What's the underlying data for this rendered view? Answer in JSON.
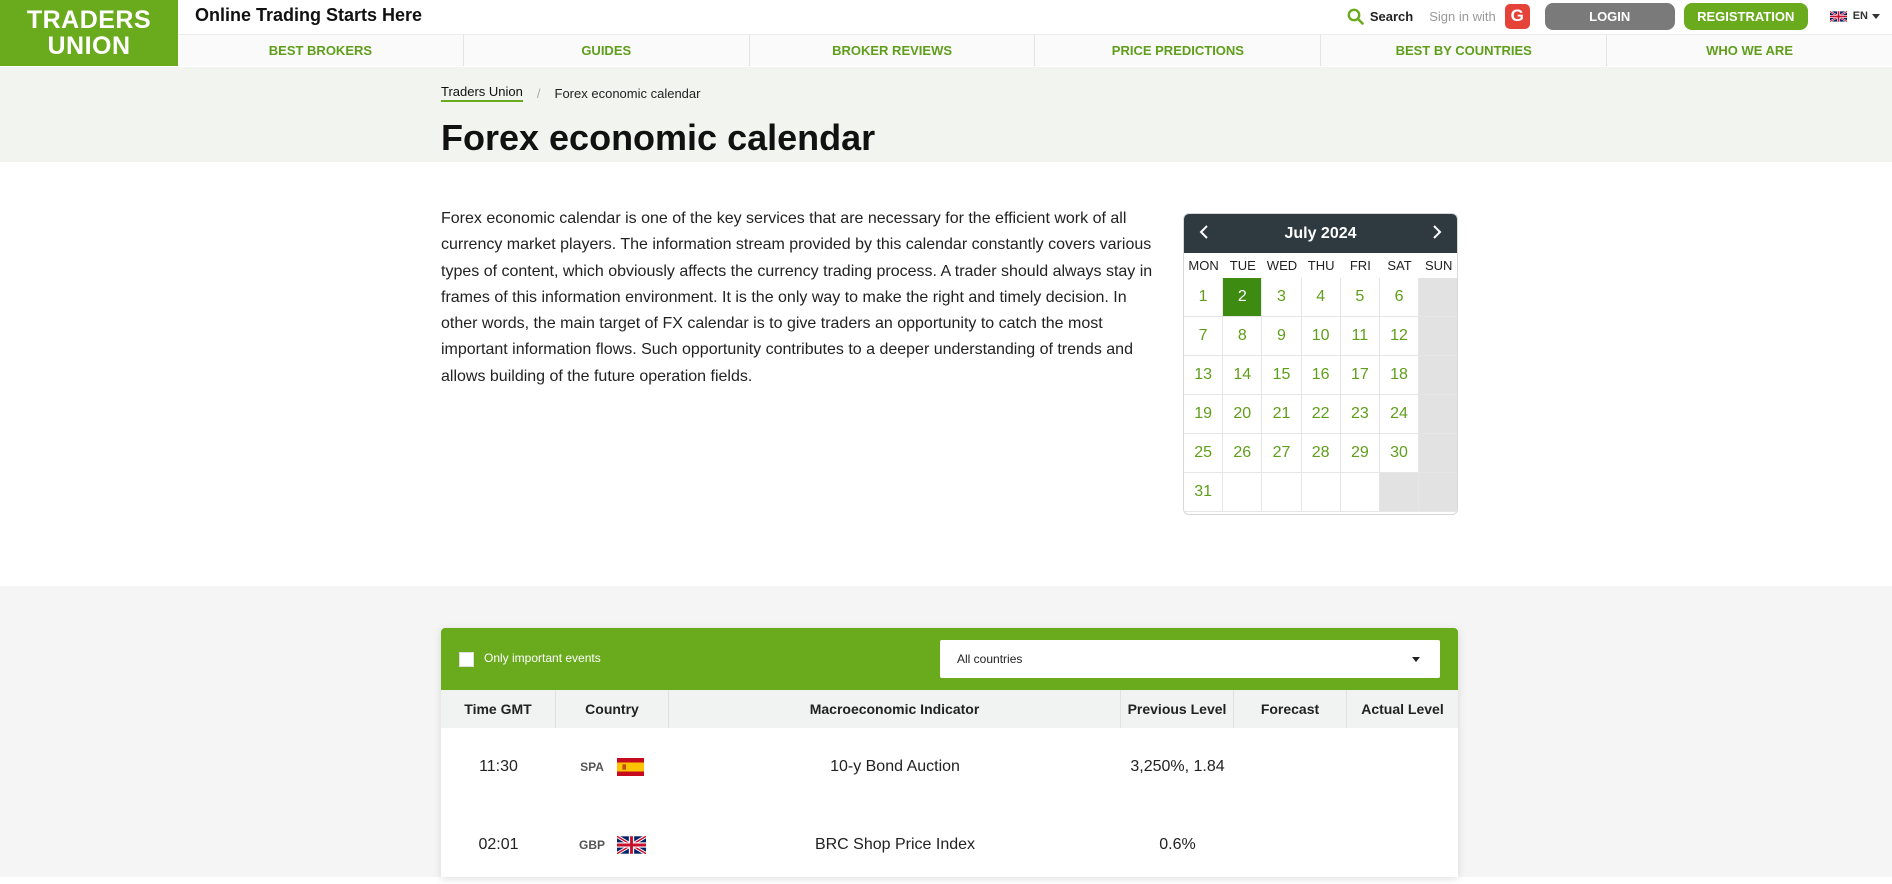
{
  "header": {
    "logo_line1": "TRADERS",
    "logo_line2": "UNION",
    "tagline": "Online Trading Starts Here",
    "search_label": "Search",
    "signin_label": "Sign in with",
    "google_label": "G",
    "login_label": "LOGIN",
    "register_label": "REGISTRATION",
    "lang_label": "EN"
  },
  "nav": {
    "items": [
      {
        "label": "BEST BROKERS"
      },
      {
        "label": "GUIDES"
      },
      {
        "label": "BROKER REVIEWS"
      },
      {
        "label": "PRICE PREDICTIONS"
      },
      {
        "label": "BEST BY COUNTRIES"
      },
      {
        "label": "WHO WE ARE"
      }
    ]
  },
  "breadcrumb": {
    "home": "Traders Union",
    "separator": "/",
    "current": "Forex economic calendar"
  },
  "page": {
    "title": "Forex economic calendar",
    "intro": "Forex economic calendar is one of the key services that are necessary for the efficient work of all currency market players. The information stream provided by this calendar constantly covers various types of content, which obviously affects the currency trading process. A trader should always stay in frames of this information environment. It is the only way to make the right and timely decision. In other words, the main target of FX calendar is to give traders an opportunity to catch the most important information flows. Such opportunity contributes to a deeper understanding of trends and allows building of the future operation fields."
  },
  "calendar": {
    "month_label": "July 2024",
    "prev_label": "‹",
    "next_label": "›",
    "weekdays": [
      "MON",
      "TUE",
      "WED",
      "THU",
      "FRI",
      "SAT",
      "SUN"
    ],
    "selected_day": "2",
    "weeks": [
      [
        "1",
        "2",
        "3",
        "4",
        "5",
        "6",
        ""
      ],
      [
        "7",
        "8",
        "9",
        "10",
        "11",
        "12",
        ""
      ],
      [
        "13",
        "14",
        "15",
        "16",
        "17",
        "18",
        ""
      ],
      [
        "19",
        "20",
        "21",
        "22",
        "23",
        "24",
        ""
      ],
      [
        "25",
        "26",
        "27",
        "28",
        "29",
        "30",
        ""
      ],
      [
        "31",
        "",
        "",
        "",
        "",
        "",
        ""
      ]
    ]
  },
  "events": {
    "filter": {
      "important_label": "Only important events",
      "country_value": "All countries"
    },
    "columns": [
      "Time GMT",
      "Country",
      "Macroeconomic Indicator",
      "Previous Level",
      "Forecast",
      "Actual Level"
    ],
    "rows": [
      {
        "time": "11:30",
        "country": "SPA",
        "flag": "spain-flag",
        "indicator": "10-y Bond Auction",
        "previous": "3,250%, 1.84",
        "forecast": "",
        "actual": ""
      },
      {
        "time": "02:01",
        "country": "GBP",
        "flag": "uk-flag",
        "indicator": "BRC Shop Price Index",
        "previous": "0.6%",
        "forecast": "",
        "actual": ""
      }
    ]
  },
  "colors": {
    "brand_green": "#6aab1d",
    "dark_header": "#2e3a40",
    "selected_day": "#3d8c11"
  }
}
